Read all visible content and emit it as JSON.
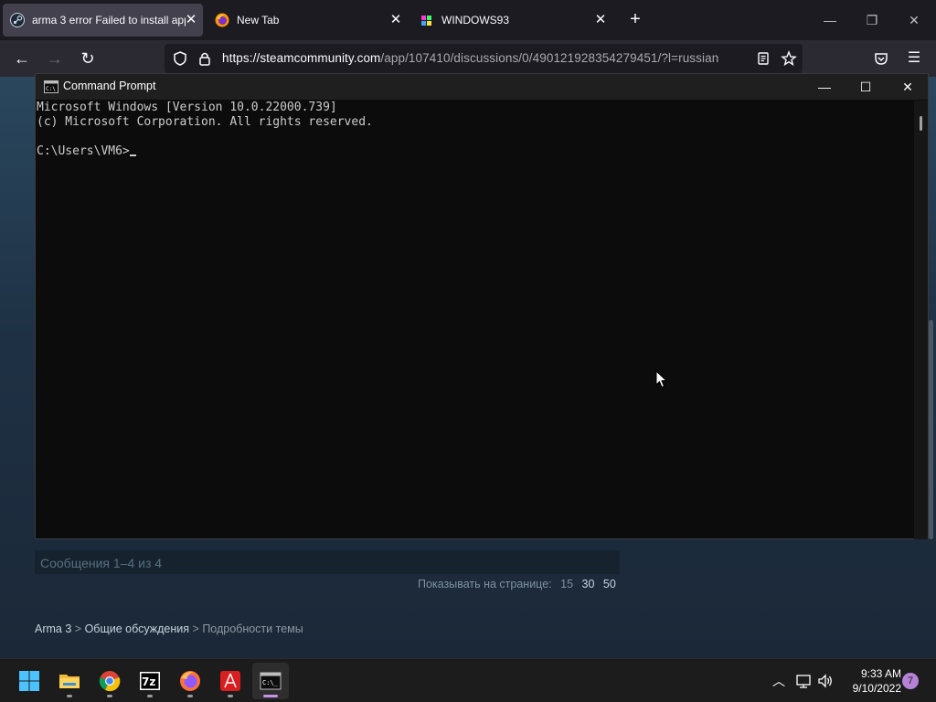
{
  "browser": {
    "tabs": [
      {
        "label": "arma 3 error Failed to install app",
        "active": true
      },
      {
        "label": "New Tab",
        "active": false
      },
      {
        "label": "WINDOWS93",
        "active": false
      }
    ],
    "url_main": "https://steamcommunity.com",
    "url_rest": "/app/107410/discussions/0/4901219283542794​51/?l=russian"
  },
  "steam": {
    "message_count": "Сообщения 1–4 из 4",
    "per_page_label": "Показывать на странице:",
    "per_page_options": [
      "15",
      "30",
      "50"
    ],
    "breadcrumb": {
      "item1": "Arma 3",
      "sep1": ">",
      "item2": "Общие обсуждения",
      "sep2": ">",
      "item3": "Подробности темы"
    }
  },
  "cmd": {
    "title": "Command Prompt",
    "lines": [
      "Microsoft Windows [Version 10.0.22000.739]",
      "(c) Microsoft Corporation. All rights reserved.",
      "",
      "C:\\Users\\VM6>"
    ]
  },
  "taskbar": {
    "time": "9:33 AM",
    "date": "9/10/2022",
    "notifications": "7"
  },
  "colors": {
    "steam_bg": "#1b2838",
    "cmd_bg": "#0c0c0c",
    "browser_tabbar": "#1c1b22",
    "accent_pink": "#c990e8"
  }
}
